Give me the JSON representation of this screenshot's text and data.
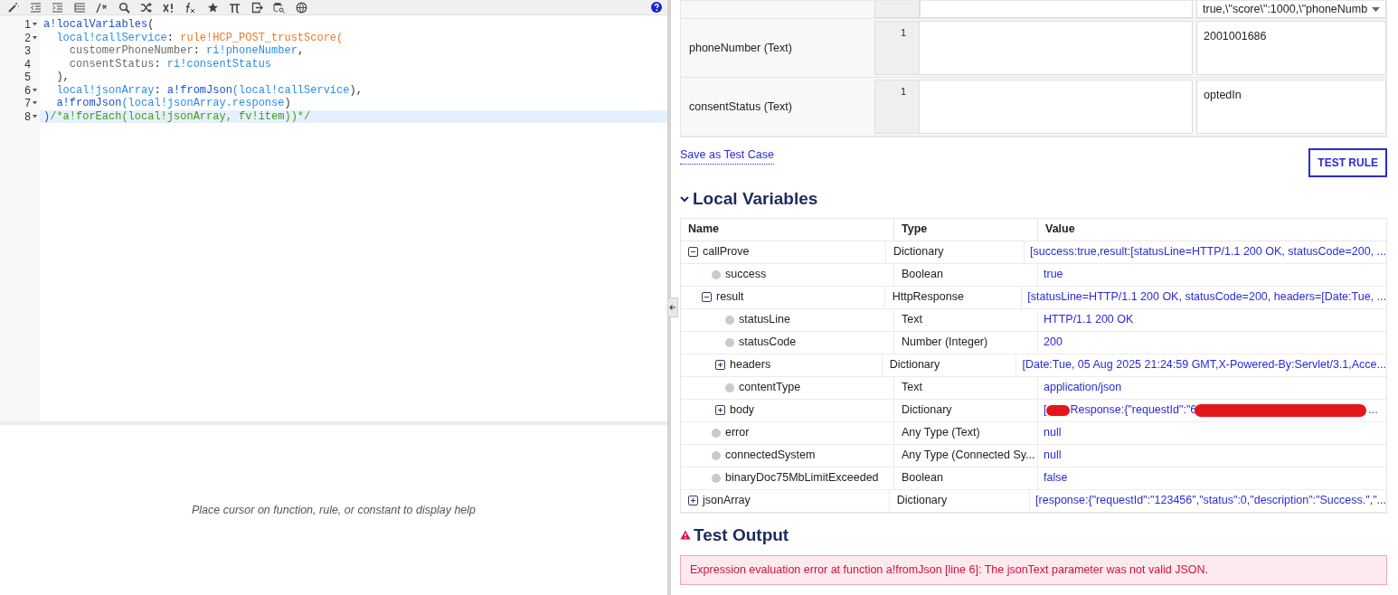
{
  "editor": {
    "lines": [
      {
        "number": "1",
        "foldable": true,
        "highlighted": false,
        "tokens": [
          {
            "kind": "fn",
            "text": "a!localVariables"
          },
          {
            "kind": "punct",
            "text": "("
          }
        ]
      },
      {
        "number": "2",
        "foldable": true,
        "highlighted": false,
        "tokens": [
          {
            "kind": "var",
            "text": "  local!callService"
          },
          {
            "kind": "punct",
            "text": ": "
          },
          {
            "kind": "rule",
            "text": "rule!HCP_POST_trustScore("
          }
        ]
      },
      {
        "number": "3",
        "foldable": false,
        "highlighted": false,
        "tokens": [
          {
            "kind": "param",
            "text": "    customerPhoneNumber"
          },
          {
            "kind": "punct",
            "text": ": "
          },
          {
            "kind": "var",
            "text": "ri!phoneNumber"
          },
          {
            "kind": "punct",
            "text": ","
          }
        ]
      },
      {
        "number": "4",
        "foldable": false,
        "highlighted": false,
        "tokens": [
          {
            "kind": "param",
            "text": "    consentStatus"
          },
          {
            "kind": "punct",
            "text": ": "
          },
          {
            "kind": "var",
            "text": "ri!consentStatus"
          }
        ]
      },
      {
        "number": "5",
        "foldable": false,
        "highlighted": false,
        "tokens": [
          {
            "kind": "punct",
            "text": "  ),"
          }
        ]
      },
      {
        "number": "6",
        "foldable": true,
        "highlighted": false,
        "tokens": [
          {
            "kind": "var",
            "text": "  local!jsonArray"
          },
          {
            "kind": "punct",
            "text": ": "
          },
          {
            "kind": "fn",
            "text": "a!fromJson"
          },
          {
            "kind": "var",
            "text": "(local!callService"
          },
          {
            "kind": "punct",
            "text": "),"
          }
        ]
      },
      {
        "number": "7",
        "foldable": true,
        "highlighted": false,
        "tokens": [
          {
            "kind": "fn",
            "text": "  a!fromJson"
          },
          {
            "kind": "var",
            "text": "(local!jsonArray.response"
          },
          {
            "kind": "punct",
            "text": ")"
          }
        ]
      },
      {
        "number": "8",
        "foldable": true,
        "highlighted": true,
        "tokens": [
          {
            "kind": "fn",
            "text": ")"
          },
          {
            "kind": "comment",
            "text": "/*a!forEach(local!jsonArray, fv!item))*/"
          }
        ]
      }
    ]
  },
  "help_pane": {
    "text": "Place cursor on function, rule, or constant to display help"
  },
  "rule_inputs": {
    "top_value": "true,\\\"score\\\":1000,\\\"phoneNumb",
    "rows": [
      {
        "label": "phoneNumber (Text)",
        "line_number": "1",
        "value": "2001001686"
      },
      {
        "label": "consentStatus (Text)",
        "line_number": "1",
        "value": "optedIn"
      }
    ]
  },
  "save_link": "Save as Test Case",
  "test_button": "TEST RULE",
  "local_variables": {
    "title": "Local Variables",
    "expanded": true,
    "columns": [
      "Name",
      "Type",
      "Value"
    ],
    "rows": [
      {
        "name": "callProve",
        "type": "Dictionary",
        "value": "[success:true,result:[statusLine=HTTP/1.1 200 OK, statusCode=200, ...",
        "expanded": true,
        "children": [
          {
            "name": "success",
            "type": "Boolean",
            "value": "true"
          },
          {
            "name": "result",
            "type": "HttpResponse",
            "value": "[statusLine=HTTP/1.1 200 OK, statusCode=200, headers=[Date:Tue, ...",
            "expanded": true,
            "children": [
              {
                "name": "statusLine",
                "type": "Text",
                "value": "HTTP/1.1 200 OK"
              },
              {
                "name": "statusCode",
                "type": "Number (Integer)",
                "value": "200"
              },
              {
                "name": "headers",
                "type": "Dictionary",
                "value": "[Date:Tue, 05 Aug 2025 21:24:59 GMT,X-Powered-By:Servlet/3.1,Acce...",
                "expanded": false
              },
              {
                "name": "contentType",
                "type": "Text",
                "value": "application/json"
              },
              {
                "name": "body",
                "type": "Dictionary",
                "value_parts": [
                  "[",
                  "Response:{\"requestId\":\"6",
                  "..."
                ],
                "expanded": false
              }
            ]
          },
          {
            "name": "error",
            "type": "Any Type (Text)",
            "value": "null"
          },
          {
            "name": "connectedSystem",
            "type": "Any Type (Connected Sy...",
            "value": "null"
          },
          {
            "name": "binaryDoc75MbLimitExceeded",
            "type": "Boolean",
            "value": "false"
          }
        ]
      },
      {
        "name": "jsonArray",
        "type": "Dictionary",
        "value": "[response:{\"requestId\":\"123456\",\"status\":0,\"description\":\"Success.\",\"...",
        "expanded": false
      }
    ]
  },
  "test_output": {
    "title": "Test Output",
    "error": "Expression evaluation error at function a!fromJson [line 6]: The jsonText parameter was not valid JSON."
  }
}
